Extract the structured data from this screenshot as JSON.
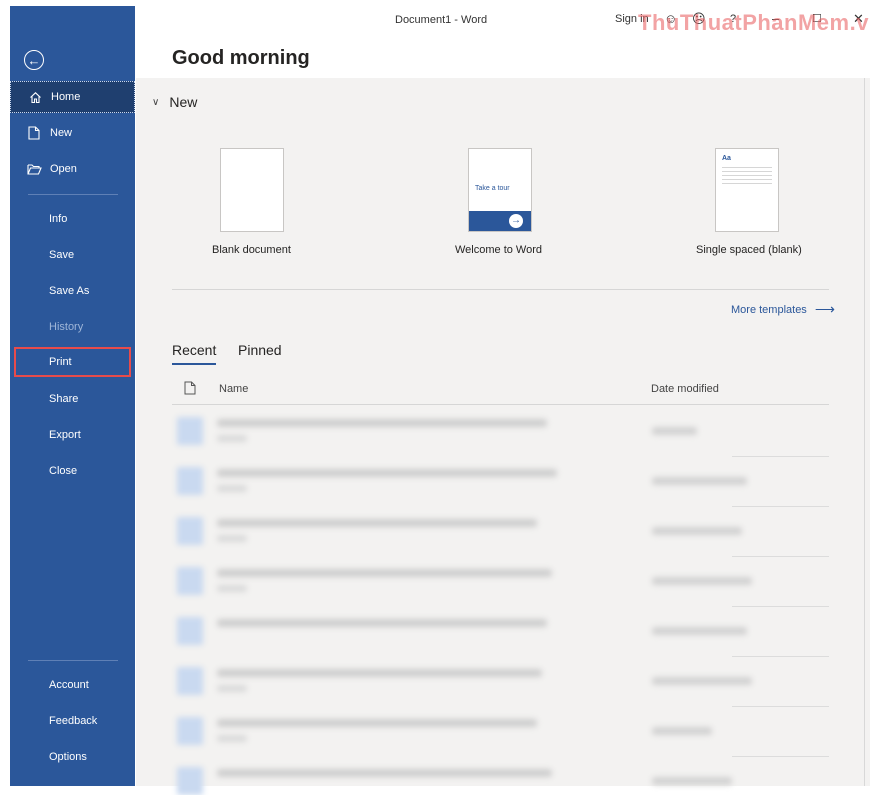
{
  "window": {
    "title": "Document1  -  Word",
    "sign_in": "Sign in",
    "watermark": "ThuThuatPhanMem.vn"
  },
  "sidebar": {
    "back_icon": "back-arrow-icon",
    "top_items": [
      {
        "label": "Home",
        "icon": "home-icon",
        "active": true
      },
      {
        "label": "New",
        "icon": "new-document-icon"
      },
      {
        "label": "Open",
        "icon": "open-folder-icon"
      }
    ],
    "middle_items": [
      {
        "label": "Info"
      },
      {
        "label": "Save"
      },
      {
        "label": "Save As"
      },
      {
        "label": "History",
        "disabled": true
      },
      {
        "label": "Print",
        "highlighted": true
      },
      {
        "label": "Share"
      },
      {
        "label": "Export"
      },
      {
        "label": "Close"
      }
    ],
    "bottom_items": [
      {
        "label": "Account"
      },
      {
        "label": "Feedback"
      },
      {
        "label": "Options"
      }
    ]
  },
  "main": {
    "greeting": "Good morning",
    "new_section": "New",
    "templates": [
      {
        "label": "Blank document"
      },
      {
        "label": "Welcome to Word",
        "thumb_text": "Take a tour"
      },
      {
        "label": "Single spaced (blank)",
        "thumb_text": "Aa"
      }
    ],
    "more_templates": "More templates",
    "tabs": [
      {
        "label": "Recent",
        "active": true
      },
      {
        "label": "Pinned"
      }
    ],
    "columns": {
      "name": "Name",
      "date": "Date modified"
    }
  },
  "colors": {
    "brand": "#2b579a",
    "highlight": "#e74b4b"
  }
}
